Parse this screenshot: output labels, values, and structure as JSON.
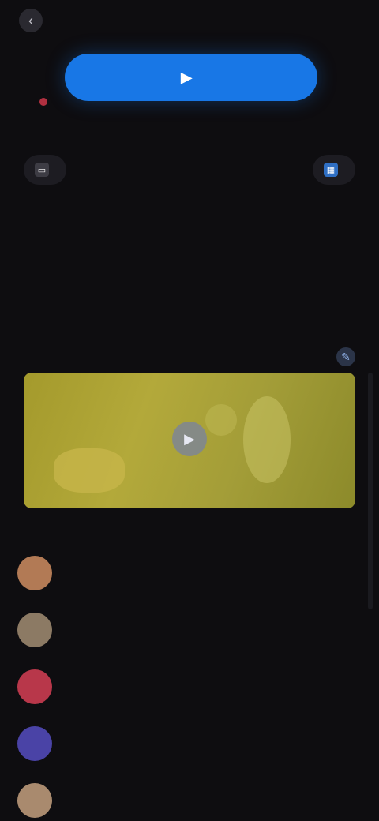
{
  "header": {
    "title": "",
    "back_icon": "back-arrow-icon"
  },
  "primary_action": {
    "label": "",
    "icon": "video-camera-icon",
    "color": "#1877e6"
  },
  "hint": {
    "text": ""
  },
  "toggles": [
    {
      "label": "",
      "icon": "monitor-icon"
    },
    {
      "label": "",
      "icon": "grid-icon"
    }
  ],
  "info": {
    "title_line1": "",
    "title_line2": "",
    "subtitle": "",
    "right_value": "",
    "right_label": "",
    "right_meta": ""
  },
  "section": {
    "label": "",
    "action_icon": "edit-icon"
  },
  "media": {
    "play_icon": "play-icon",
    "background": "#a8a033"
  },
  "list": [
    {
      "name": "",
      "avatar_color": "#b27a55"
    },
    {
      "name": "",
      "avatar_color": "#8c7a64"
    },
    {
      "name": "",
      "avatar_color": "#b8374a"
    },
    {
      "name": "",
      "avatar_color": "#4a43a6"
    },
    {
      "name": "",
      "sub": "",
      "avatar_color": "#a98a6e"
    }
  ]
}
